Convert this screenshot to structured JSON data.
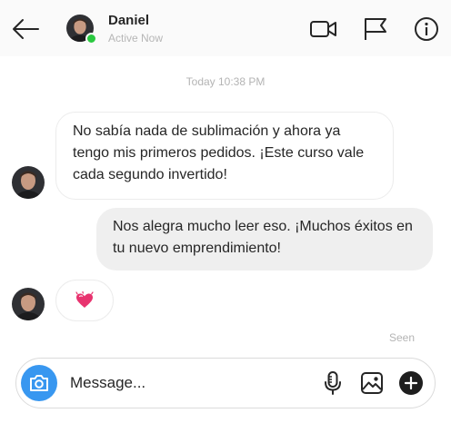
{
  "header": {
    "contact_name": "Daniel",
    "status": "Active Now",
    "icons": [
      "back-arrow-icon",
      "video-camera-icon",
      "flag-icon",
      "info-icon"
    ]
  },
  "thread": {
    "timestamp": "Today 10:38 PM",
    "messages": [
      {
        "direction": "incoming",
        "text": "No sabía nada de sublimación y ahora ya tengo mis primeros pedidos. ¡Este curso vale cada segundo invertido!"
      },
      {
        "direction": "outgoing",
        "text": "Nos alegra mucho leer eso. ¡Muchos éxitos en tu nuevo emprendimiento!"
      },
      {
        "direction": "incoming",
        "reaction": "sparkling-heart-emoji"
      }
    ],
    "seen_label": "Seen"
  },
  "composer": {
    "placeholder": "Message...",
    "icons": [
      "camera-icon",
      "microphone-icon",
      "gallery-icon",
      "plus-icon"
    ]
  },
  "colors": {
    "online": "#2ac940",
    "camera_button": "#3897f0",
    "outgoing_bubble": "#efefef",
    "heart": "#e8336f"
  }
}
